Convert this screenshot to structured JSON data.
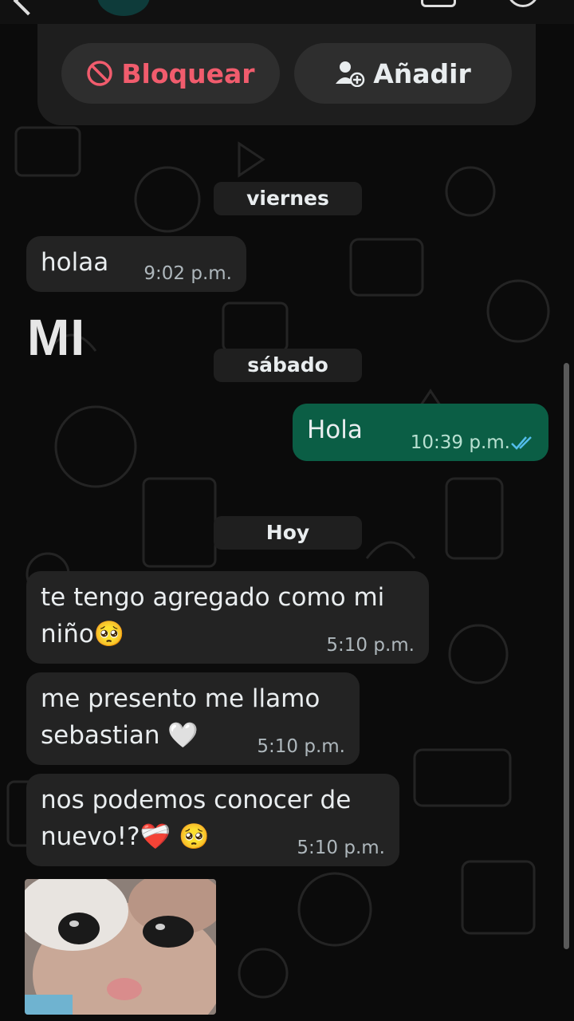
{
  "actions": {
    "block_label": "Bloquear",
    "add_label": "Añadir"
  },
  "dates": {
    "first": "viernes",
    "second": "sábado",
    "third": "Hoy"
  },
  "sticker_text": "MI",
  "messages": [
    {
      "text": "holaa",
      "time": "9:02 p.m."
    },
    {
      "text": "Hola",
      "time": "10:39 p.m."
    },
    {
      "text": "te tengo agregado como mi\nniño🥺",
      "time": "5:10 p.m."
    },
    {
      "text": "me presento me llamo\nsebastian 🤍",
      "time": "5:10 p.m."
    },
    {
      "text": "nos podemos conocer de\nnuevo!?❤️‍🩹 🥺",
      "time": "5:10 p.m."
    }
  ],
  "colors": {
    "block_red": "#f15c6d",
    "outgoing_bubble": "#0b5e45",
    "incoming_bubble": "#232323",
    "read_ticks": "#53bdeb"
  }
}
